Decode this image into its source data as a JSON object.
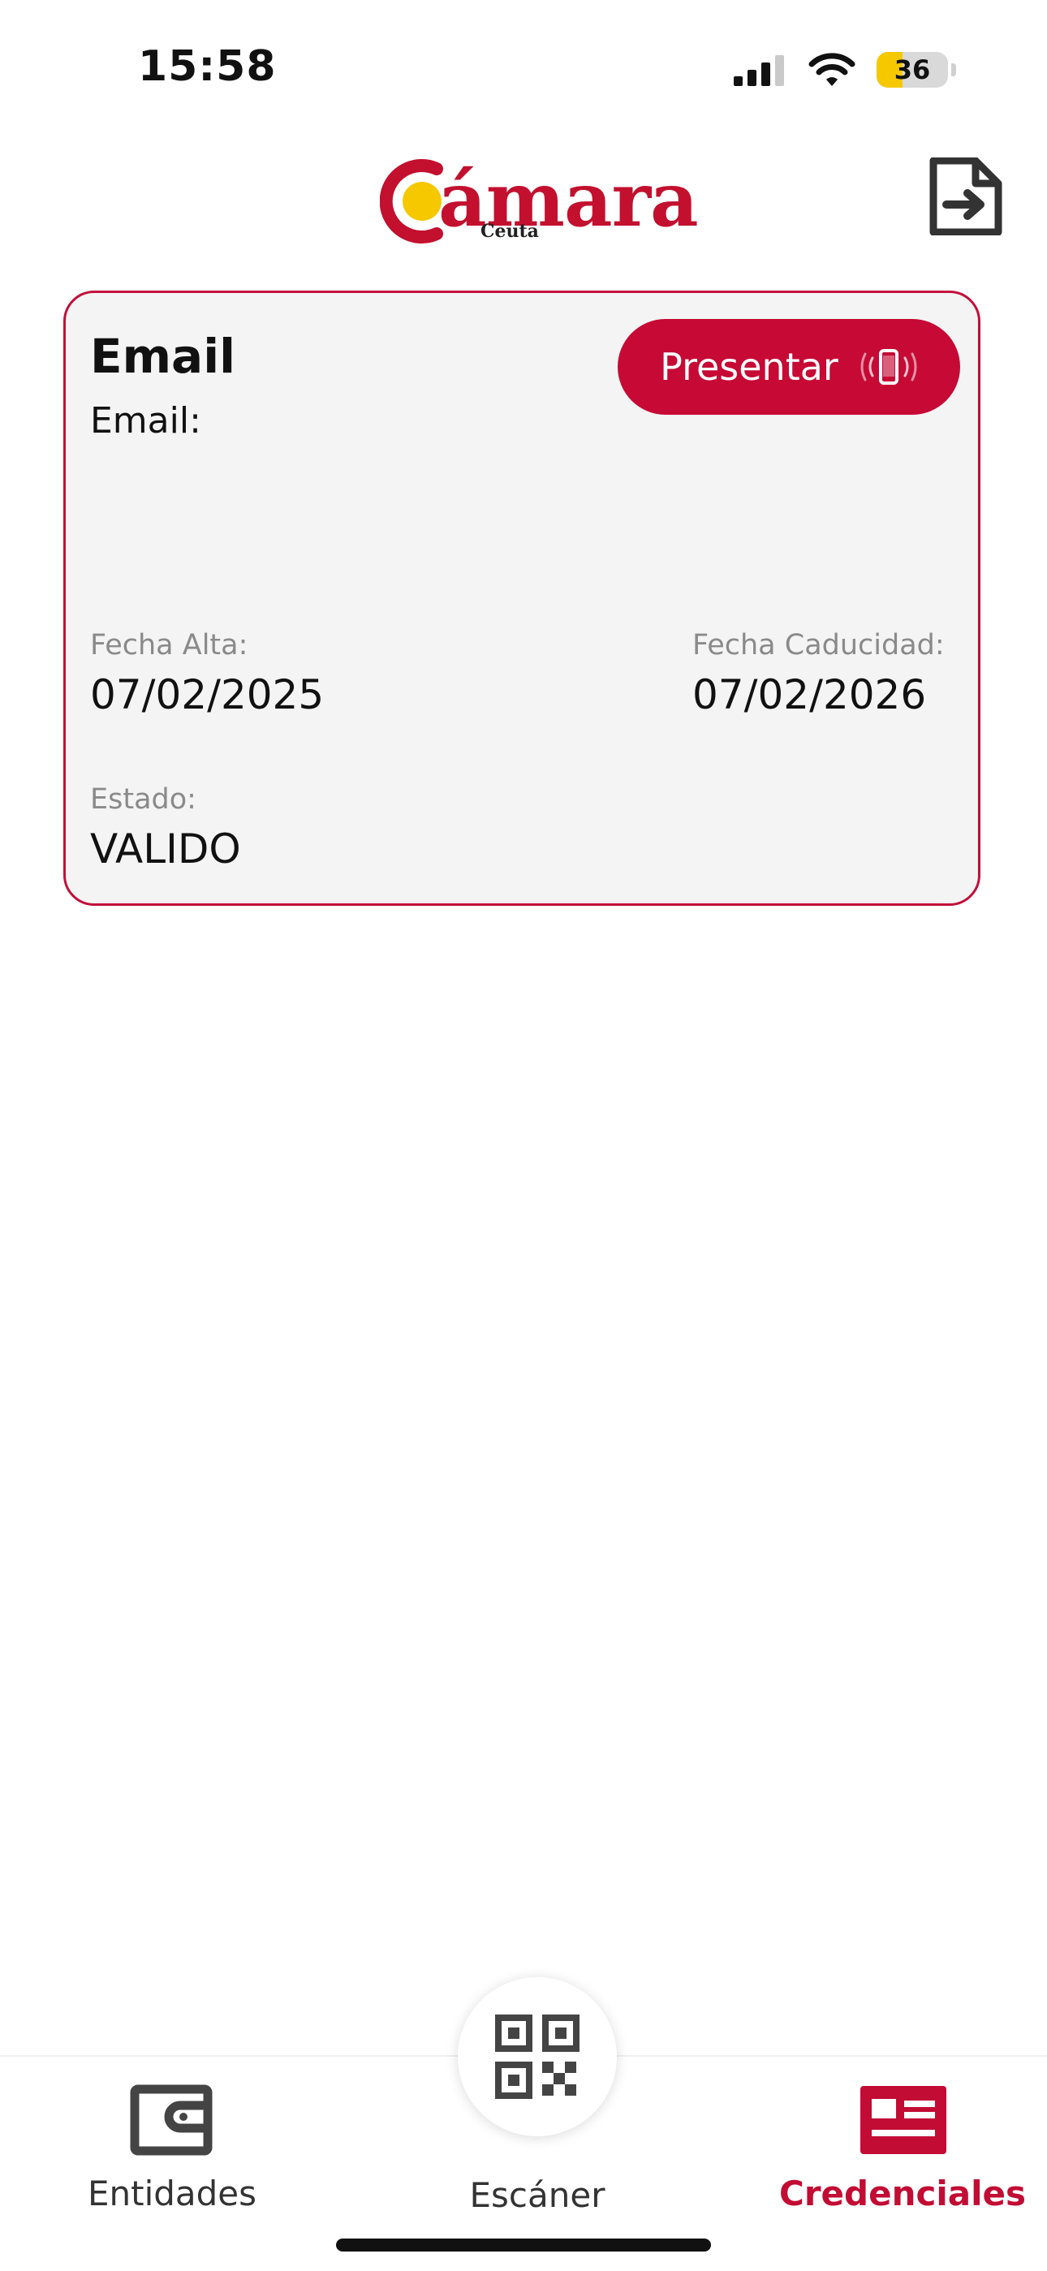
{
  "status_bar": {
    "time": "15:58",
    "battery": "36",
    "battery_color": "#f5c800"
  },
  "header": {
    "logo_text": "ámara",
    "logo_subtitle": "Ceuta",
    "logout_icon": "logout-icon"
  },
  "card": {
    "title": "Email",
    "email_label": "Email:",
    "present_button": "Presentar",
    "present_icon": "phone-vibrate-icon",
    "fecha_alta_label": "Fecha Alta:",
    "fecha_alta_value": "07/02/2025",
    "fecha_caducidad_label": "Fecha Caducidad:",
    "fecha_caducidad_value": "07/02/2026",
    "estado_label": "Estado:",
    "estado_value": "VALIDO"
  },
  "nav": {
    "entidades": "Entidades",
    "escaner": "Escáner",
    "credenciales": "Credenciales",
    "active": "credenciales",
    "accent_color": "#c20c34"
  }
}
